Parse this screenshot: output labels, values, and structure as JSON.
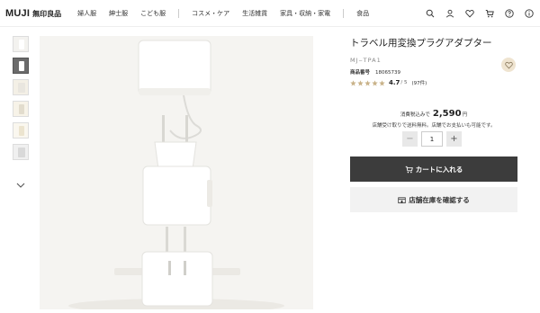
{
  "header": {
    "logo_en": "MUJI",
    "logo_jp": "無印良品",
    "nav": [
      "婦人服",
      "紳士服",
      "こども服",
      "コスメ・ケア",
      "生活雑貨",
      "家具・収納・家電",
      "食品"
    ],
    "icons": [
      "search-icon",
      "user-icon",
      "heart-icon",
      "cart-icon",
      "help-icon",
      "info-icon"
    ]
  },
  "gallery": {
    "thumbnails": 6,
    "selected_index": 1,
    "more_icon": "chevron-down-icon"
  },
  "product": {
    "title": "トラベル用変換プラグアダプター",
    "model": "MJ‒TPA1",
    "product_no_label": "商品番号",
    "product_no": "18065739",
    "rating": "4.7",
    "rating_max": "/ 5",
    "rating_count": "(97件)",
    "stars_filled": 5
  },
  "purchase": {
    "tax_label": "消費税込みで",
    "price": "2,590",
    "currency": "円",
    "shipping_note": "店舗受け取りで送料無料。店舗でお支払いも可能です。",
    "quantity": "1",
    "minus_label": "−",
    "plus_label": "+",
    "cart_button": "カートに入れる",
    "store_button": "店舗在庫を確認する"
  },
  "colors": {
    "cart_bg": "#3c3c3c",
    "star": "#c9b38a",
    "favorite_bg": "#efe4d0"
  }
}
